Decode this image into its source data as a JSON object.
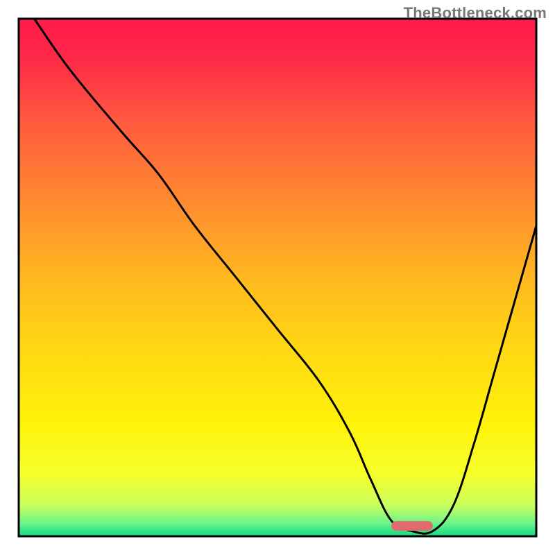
{
  "watermark": "TheBottleneck.com",
  "chart_data": {
    "type": "line",
    "title": "",
    "xlabel": "",
    "ylabel": "",
    "xlim": [
      0,
      100
    ],
    "ylim": [
      0,
      100
    ],
    "x": [
      3,
      10,
      20,
      27,
      34,
      42,
      50,
      58,
      64,
      68,
      72,
      76,
      80,
      84,
      88,
      92,
      96,
      100
    ],
    "values": [
      100,
      90,
      78,
      70,
      60,
      50,
      40,
      30,
      20,
      11,
      3,
      1,
      1,
      6,
      18,
      32,
      46,
      60
    ],
    "annotations": {
      "marker": {
        "x_start": 72,
        "x_end": 80,
        "y": 2
      }
    },
    "background": {
      "gradient_stops": [
        {
          "offset": 0.0,
          "color": "#ff1a4b"
        },
        {
          "offset": 0.08,
          "color": "#ff2a48"
        },
        {
          "offset": 0.2,
          "color": "#ff5a3e"
        },
        {
          "offset": 0.35,
          "color": "#ff8a30"
        },
        {
          "offset": 0.5,
          "color": "#ffb81f"
        },
        {
          "offset": 0.64,
          "color": "#ffd813"
        },
        {
          "offset": 0.78,
          "color": "#fff20a"
        },
        {
          "offset": 0.88,
          "color": "#f6ff2a"
        },
        {
          "offset": 0.94,
          "color": "#c9ff5e"
        },
        {
          "offset": 0.975,
          "color": "#6cf58a"
        },
        {
          "offset": 1.0,
          "color": "#10d97e"
        }
      ]
    }
  }
}
